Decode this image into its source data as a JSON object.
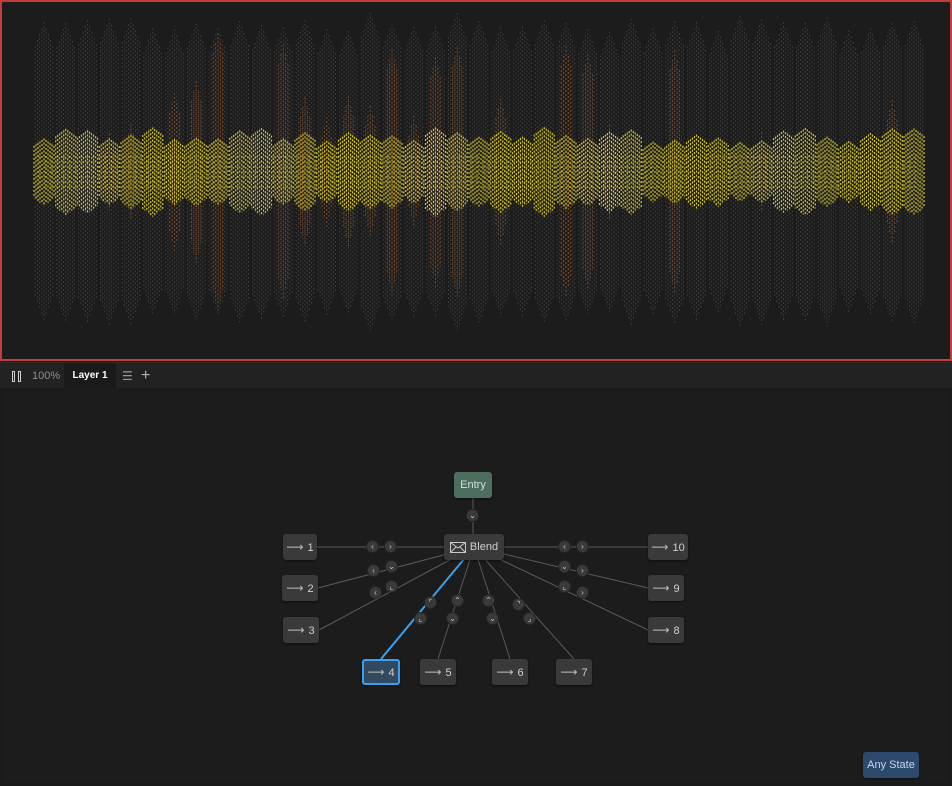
{
  "visualizer": {
    "label": "audio-spectrum"
  },
  "toolbar": {
    "zoom": "100%",
    "layer_tab": "Layer 1",
    "menu_icon": "list-icon",
    "add_icon": "plus-icon"
  },
  "graph": {
    "entry": "Entry",
    "blend": "Blend",
    "any_state": "Any State",
    "states": [
      {
        "label": "1"
      },
      {
        "label": "2"
      },
      {
        "label": "3"
      },
      {
        "label": "4"
      },
      {
        "label": "5"
      },
      {
        "label": "6"
      },
      {
        "label": "7"
      },
      {
        "label": "8"
      },
      {
        "label": "9"
      },
      {
        "label": "10"
      }
    ],
    "selected_state": "4"
  },
  "colors": {
    "accent_blue": "#3aa0f0",
    "border_red": "#c23d3d",
    "entry_green": "#4d6d5e",
    "any_state_blue": "#2d4a6e",
    "spectrum_yellow": "#e8d82a",
    "spectrum_orange": "#d2722a"
  }
}
